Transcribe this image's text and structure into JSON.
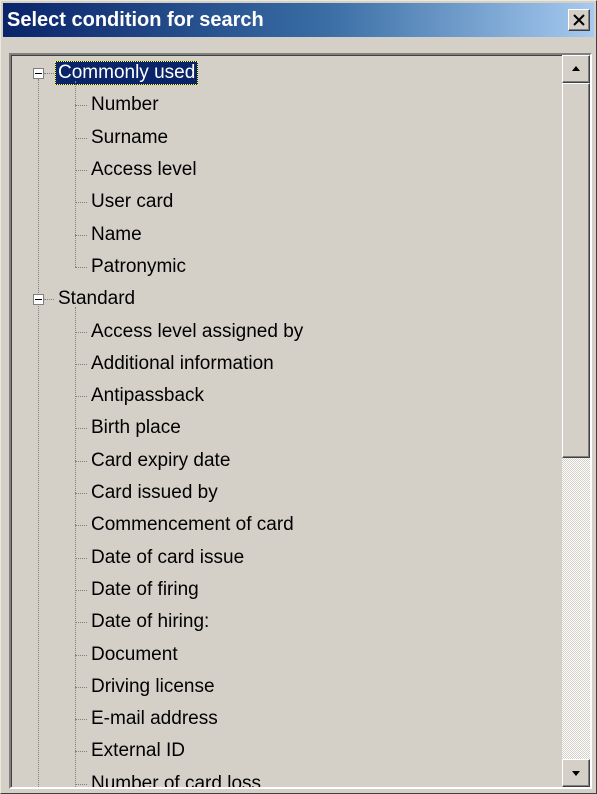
{
  "window": {
    "title": "Select condition for search",
    "close_glyph": "✕"
  },
  "tree": {
    "groups": [
      {
        "label": "Commonly used",
        "expanded": true,
        "selected": true,
        "items": [
          "Number",
          "Surname",
          "Access level",
          "User card",
          "Name",
          "Patronymic"
        ]
      },
      {
        "label": "Standard",
        "expanded": true,
        "selected": false,
        "items": [
          "Access level assigned by",
          "Additional information",
          "Antipassback",
          "Birth place",
          "Card expiry date",
          "Card issued by",
          "Commencement of card",
          "Date of card issue",
          "Date of firing",
          "Date of hiring:",
          "Document",
          "Driving license",
          "E-mail address",
          "External ID",
          "Number of card loss"
        ]
      }
    ]
  },
  "scrollbar": {
    "up_icon": "scroll-up-arrow-icon",
    "down_icon": "scroll-down-arrow-icon"
  },
  "colors": {
    "title_bar": "#0a246a",
    "selection": "#0a246a",
    "face": "#d4d0c8"
  }
}
